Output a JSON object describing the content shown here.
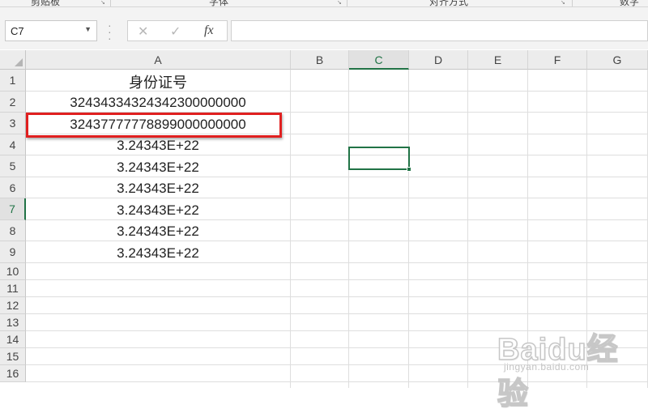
{
  "ribbon": {
    "groups": [
      "剪贴板",
      "字体",
      "对齐方式",
      "数字"
    ]
  },
  "formula_bar": {
    "name_box": "C7",
    "cancel_icon": "✕",
    "enter_icon": "✓",
    "fx_label": "fx",
    "formula_value": ""
  },
  "sheet": {
    "columns": [
      "A",
      "B",
      "C",
      "D",
      "E",
      "F",
      "G"
    ],
    "selected_column": "C",
    "rows": [
      "1",
      "2",
      "3",
      "4",
      "5",
      "6",
      "7",
      "8",
      "9",
      "10",
      "11",
      "12",
      "13",
      "14",
      "15",
      "16"
    ],
    "selected_row": "7",
    "cells_A": [
      "身份证号",
      "32434334324342300000000",
      "32437777778899000000000",
      "3.24343E+22",
      "3.24343E+22",
      "3.24343E+22",
      "3.24343E+22",
      "3.24343E+22",
      "3.24343E+22"
    ],
    "active_cell": "C7",
    "highlight_color": "#e02020",
    "accent_color": "#217346"
  },
  "watermark": {
    "main": "Baidu经验",
    "sub": "jingyan.baidu.com"
  }
}
